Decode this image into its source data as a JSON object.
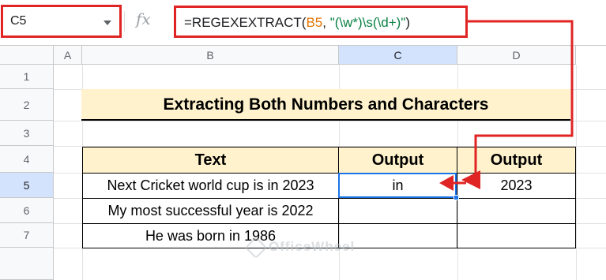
{
  "formula_bar": {
    "name_box": "C5",
    "fx_icon": "fx-icon",
    "formula_parts": [
      {
        "text": "=REGEXEXTRACT(",
        "class": "f-black"
      },
      {
        "text": "B5",
        "class": "f-ref"
      },
      {
        "text": ", ",
        "class": "f-black"
      },
      {
        "text": "\"(\\w*)\\s(\\d+)\"",
        "class": "f-str"
      },
      {
        "text": ")",
        "class": "f-black"
      }
    ]
  },
  "columns": [
    "A",
    "B",
    "C",
    "D"
  ],
  "rows": [
    "1",
    "2",
    "3",
    "4",
    "5",
    "6",
    "7"
  ],
  "title": "Extracting Both Numbers and Characters",
  "table": {
    "headers": [
      "Text",
      "Output",
      "Output"
    ],
    "rows": [
      [
        "Next Cricket world cup is in 2023",
        "in",
        "2023"
      ],
      [
        "My most successful year is 2022",
        "",
        ""
      ],
      [
        "He was born in 1986",
        "",
        ""
      ]
    ]
  },
  "watermark": "OfficeWheel",
  "colors": {
    "highlight_red": "#e02424",
    "header_fill": "#fff2cc",
    "selection_blue": "#1a73e8"
  }
}
